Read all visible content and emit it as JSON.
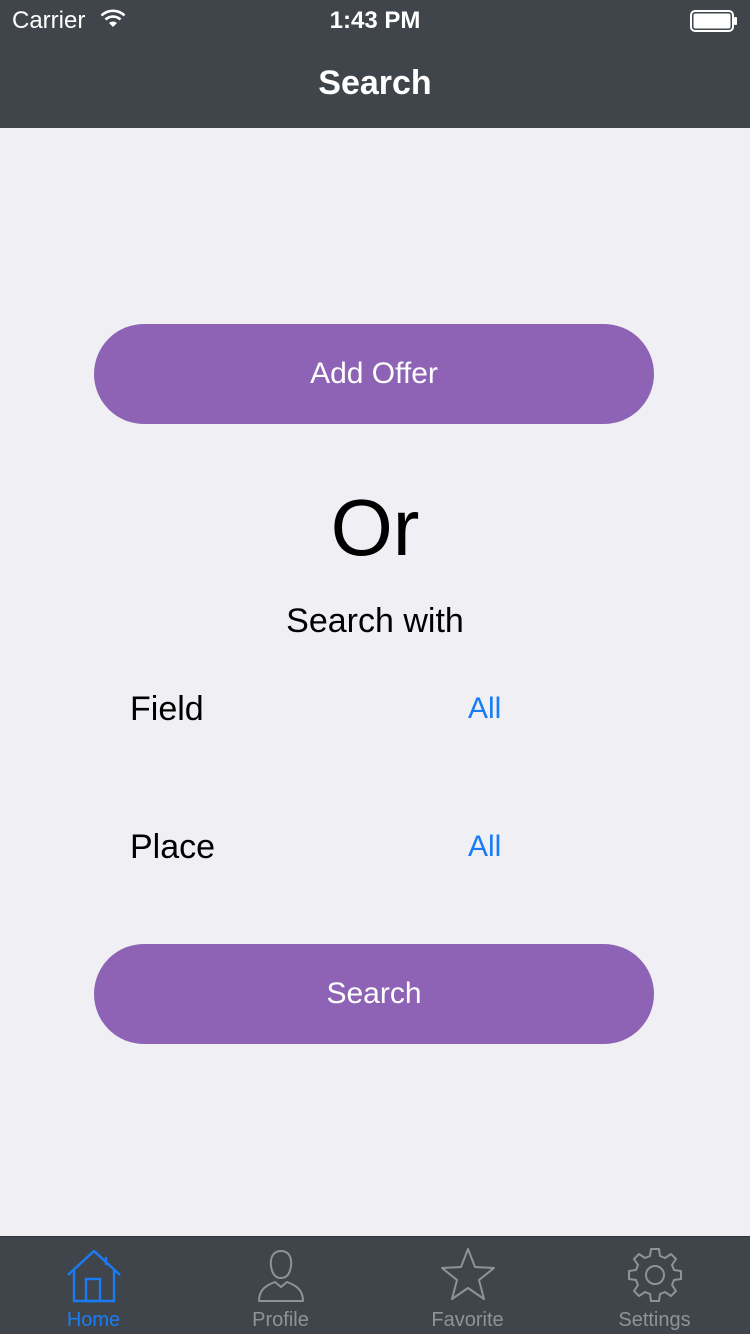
{
  "status_bar": {
    "carrier": "Carrier",
    "time": "1:43 PM"
  },
  "nav": {
    "title": "Search"
  },
  "main": {
    "add_offer_label": "Add Offer",
    "or_text": "Or",
    "search_with_text": "Search with",
    "field_label": "Field",
    "field_value": "All",
    "place_label": "Place",
    "place_value": "All",
    "search_button_label": "Search"
  },
  "tabbar": {
    "items": [
      {
        "label": "Home",
        "icon": "home-icon",
        "active": true
      },
      {
        "label": "Profile",
        "icon": "profile-icon",
        "active": false
      },
      {
        "label": "Favorite",
        "icon": "star-icon",
        "active": false
      },
      {
        "label": "Settings",
        "icon": "gear-icon",
        "active": false
      }
    ]
  },
  "colors": {
    "bar_background": "#40454b",
    "accent_purple": "#8e63b5",
    "link_blue": "#1a7cf5",
    "page_background": "#efeff4",
    "inactive_tab": "#8f9399"
  }
}
